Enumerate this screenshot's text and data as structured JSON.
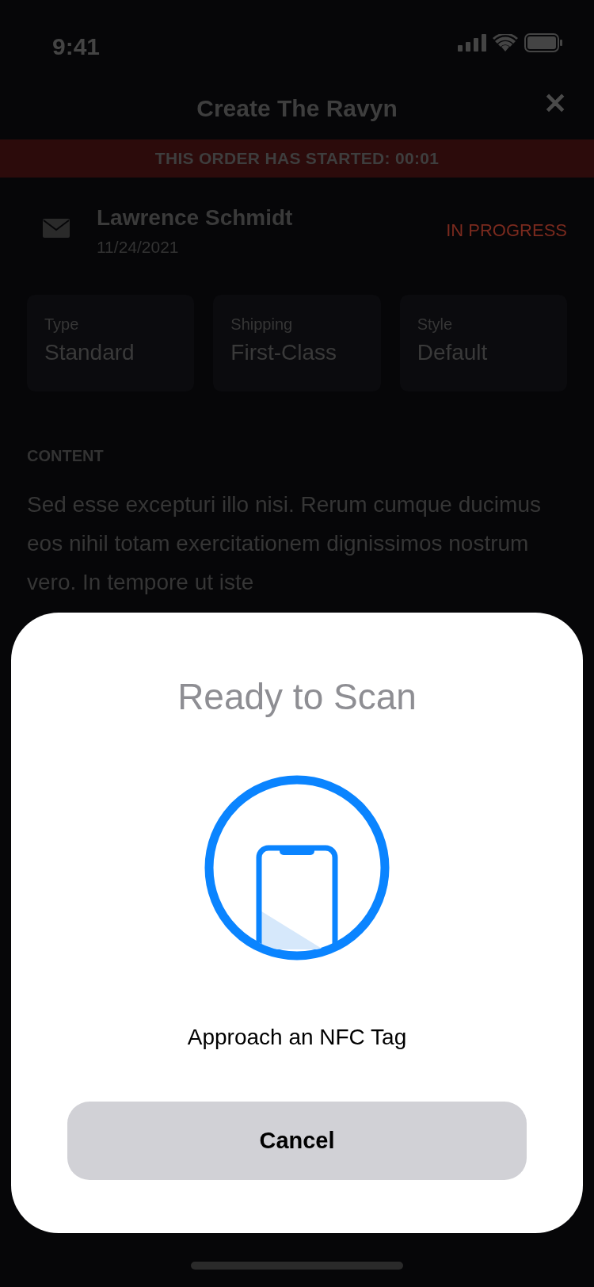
{
  "status_bar": {
    "time": "9:41"
  },
  "header": {
    "title": "Create The Ravyn",
    "close": "✕"
  },
  "banner": {
    "text": "THIS ORDER HAS STARTED: 00:01"
  },
  "order": {
    "name": "Lawrence Schmidt",
    "date": "11/24/2021",
    "status": "IN PROGRESS"
  },
  "details": [
    {
      "label": "Type",
      "value": "Standard"
    },
    {
      "label": "Shipping",
      "value": "First-Class"
    },
    {
      "label": "Style",
      "value": "Default"
    }
  ],
  "content": {
    "heading": "CONTENT",
    "text": "Sed esse excepturi illo nisi. Rerum cumque ducimus eos nihil totam exercitationem dignissimos nostrum vero. In tempore ut iste"
  },
  "scan_sheet": {
    "title": "Ready to Scan",
    "message": "Approach an NFC Tag",
    "cancel": "Cancel"
  }
}
